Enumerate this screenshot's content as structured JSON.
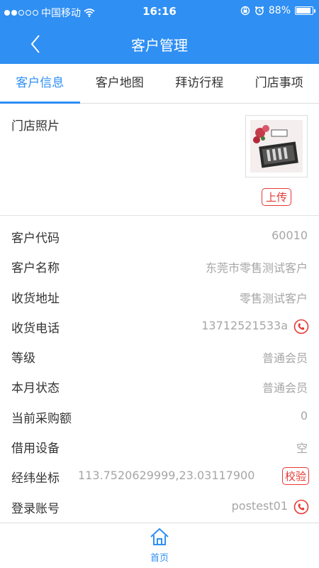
{
  "status_bar": {
    "carrier": "中国移动",
    "time": "16:16",
    "battery": "88%"
  },
  "nav": {
    "title": "客户管理"
  },
  "tabs": [
    {
      "label": "客户信息",
      "active": true
    },
    {
      "label": "客户地图",
      "active": false
    },
    {
      "label": "拜访行程",
      "active": false
    },
    {
      "label": "门店事项",
      "active": false
    }
  ],
  "photo": {
    "label": "门店照片",
    "upload_label": "上传"
  },
  "fields": {
    "code": {
      "label": "客户代码",
      "value": "60010"
    },
    "name": {
      "label": "客户名称",
      "value": "东莞市零售测试客户"
    },
    "address": {
      "label": "收货地址",
      "value": "零售测试客户"
    },
    "phone": {
      "label": "收货电话",
      "value": "13712521533a"
    },
    "level": {
      "label": "等级",
      "value": "普通会员"
    },
    "month_status": {
      "label": "本月状态",
      "value": "普通会员"
    },
    "purchase": {
      "label": "当前采购额",
      "value": "0"
    },
    "equipment": {
      "label": "借用设备",
      "value": "空"
    },
    "coords": {
      "label": "经纬坐标",
      "value": "113.7520629999,23.03117900",
      "verify_label": "校验"
    },
    "account": {
      "label": "登录账号",
      "value": "postest01"
    }
  },
  "bottom_nav": {
    "home_label": "首页"
  },
  "colors": {
    "primary": "#2f8ff3",
    "danger": "#e53935"
  }
}
